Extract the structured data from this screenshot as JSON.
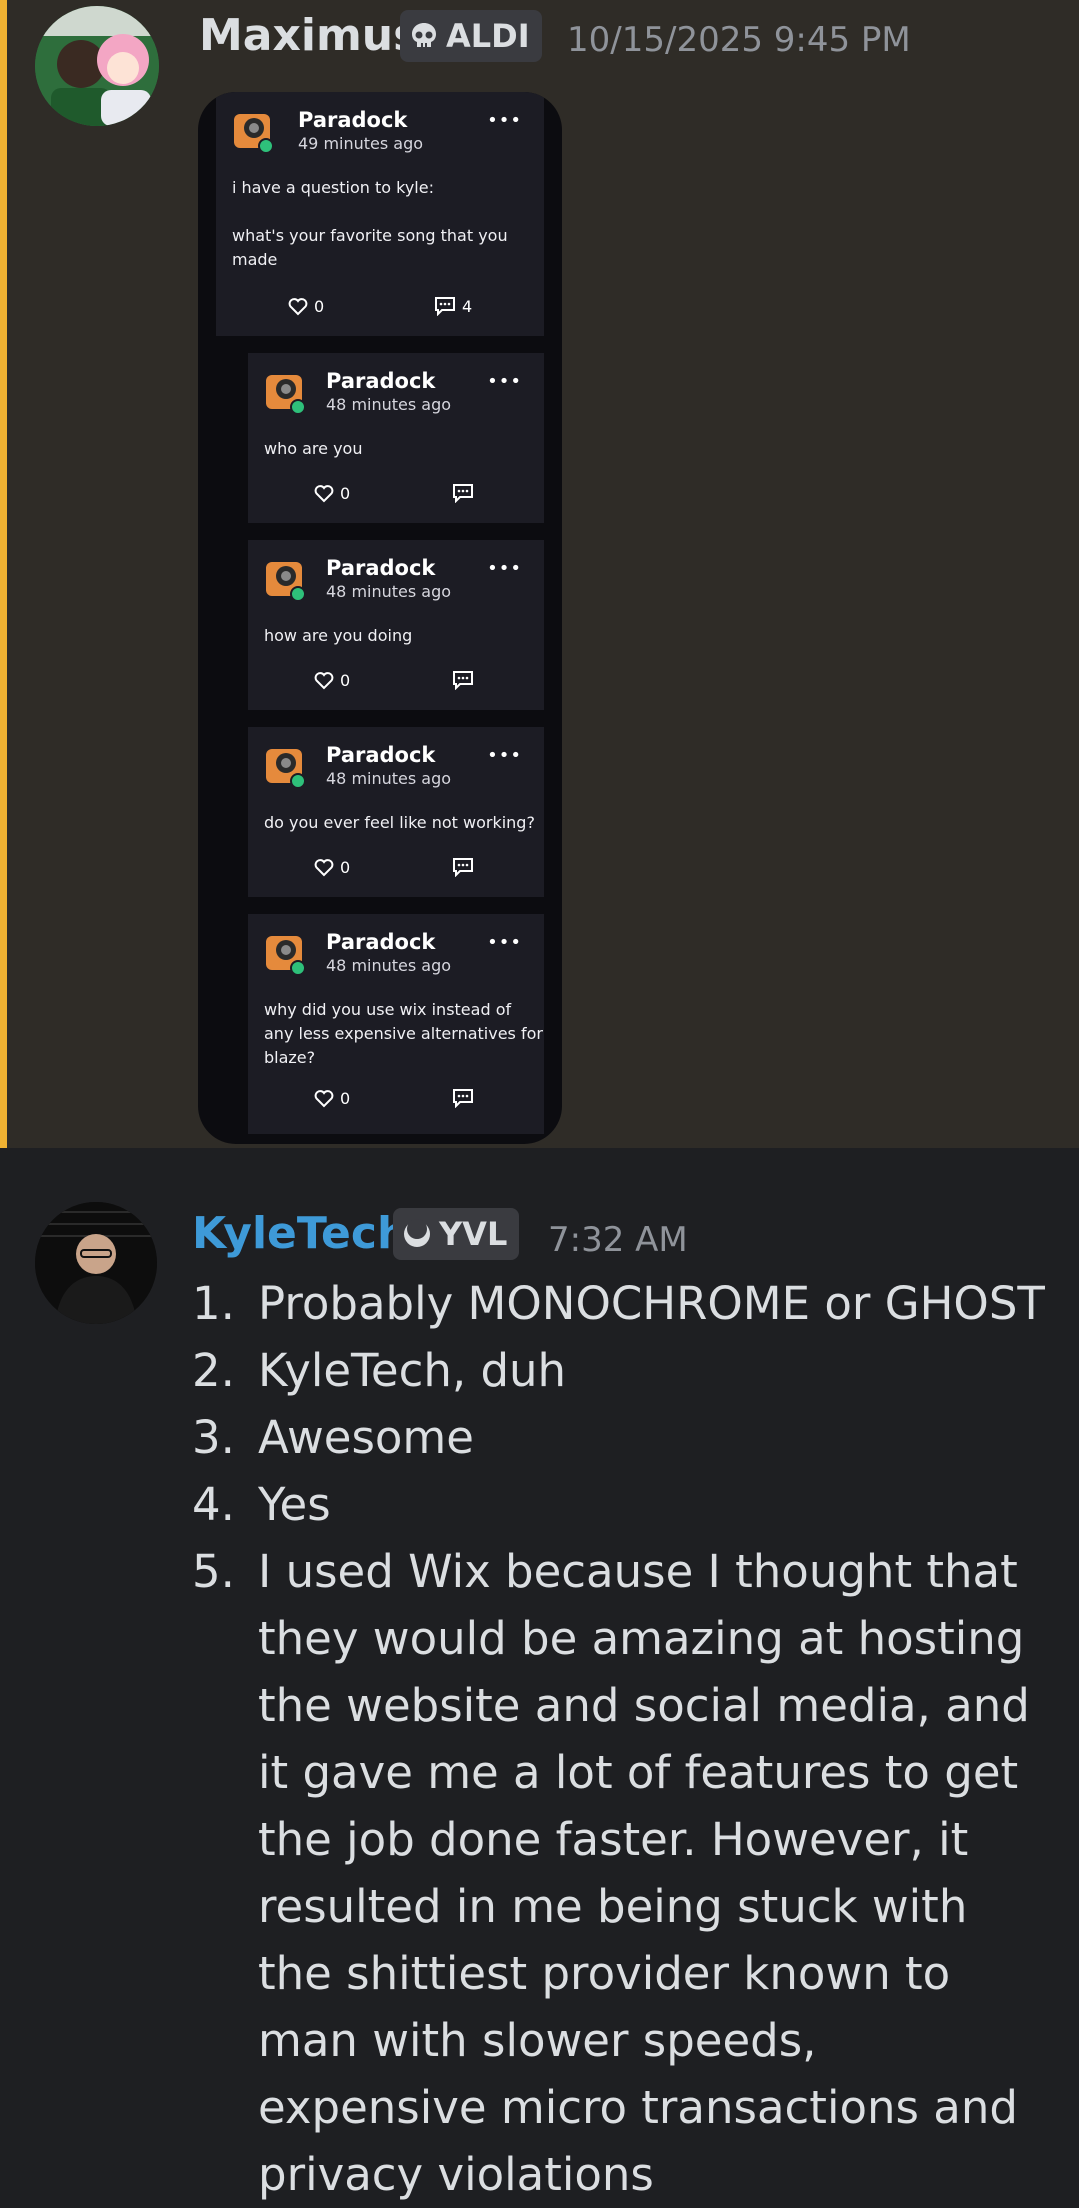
{
  "message1": {
    "username": "Maximus",
    "username_color": "#ffffff",
    "tag": "ALDI",
    "tag_icon": "skull-icon",
    "timestamp": "10/15/2025 9:45 PM",
    "highlight_color": "#f0b232",
    "embed": {
      "post": {
        "author": "Paradock",
        "ago": "49 minutes ago",
        "text": "i have a question to kyle:\n\nwhat's your favorite song that you\nmade",
        "likes": "0",
        "comments": "4"
      },
      "replies": [
        {
          "author": "Paradock",
          "ago": "48 minutes ago",
          "text": "who are you",
          "likes": "0"
        },
        {
          "author": "Paradock",
          "ago": "48 minutes ago",
          "text": "how are you doing",
          "likes": "0"
        },
        {
          "author": "Paradock",
          "ago": "48 minutes ago",
          "text": "do you ever feel like not working?",
          "likes": "0"
        },
        {
          "author": "Paradock",
          "ago": "48 minutes ago",
          "text": "why did you use wix instead of\nany less expensive alternatives for\nblaze?",
          "likes": "0"
        }
      ]
    }
  },
  "message2": {
    "username": "KyleTech",
    "username_color": "#3e9ad8",
    "tag": "YVL",
    "tag_icon": "moon-icon",
    "timestamp": "7:32 AM",
    "list": [
      {
        "num": "1.",
        "text": "Probably MONOCHROME or GHOST"
      },
      {
        "num": "2.",
        "text": "KyleTech, duh"
      },
      {
        "num": "3.",
        "text": "Awesome"
      },
      {
        "num": "4.",
        "text": "Yes"
      },
      {
        "num": "5.",
        "text": "I used Wix because I thought that they would be amazing at hosting the website and social media, and it gave me a lot of features to get the job done faster. However, it resulted in me being stuck with the shittiest provider known to man with slower speeds, expensive micro transactions and privacy violations"
      }
    ]
  }
}
